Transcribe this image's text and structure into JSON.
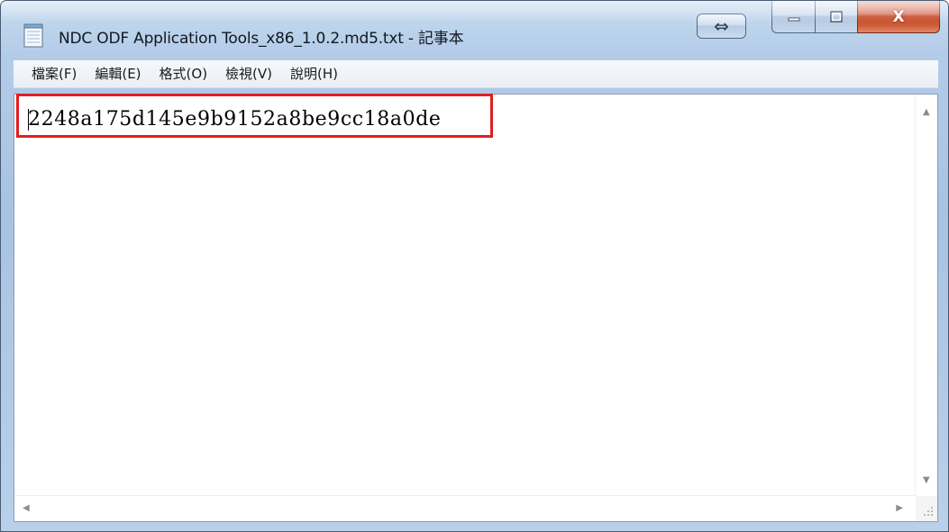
{
  "window": {
    "title": "NDC ODF Application Tools_x86_1.0.2.md5.txt - 記事本",
    "icons": {
      "app": "notepad-icon",
      "resize": "resize-arrows-icon",
      "minimize": "minimize-icon",
      "maximize": "maximize-icon",
      "close": "close-icon"
    },
    "resize_glyph": "⇔",
    "close_glyph": "X"
  },
  "menu": {
    "items": [
      {
        "label": "檔案(F)"
      },
      {
        "label": "編輯(E)"
      },
      {
        "label": "格式(O)"
      },
      {
        "label": "檢視(V)"
      },
      {
        "label": "說明(H)"
      }
    ]
  },
  "document": {
    "content": "2248a175d145e9b9152a8be9cc18a0de",
    "highlight_color": "#e0201f"
  }
}
